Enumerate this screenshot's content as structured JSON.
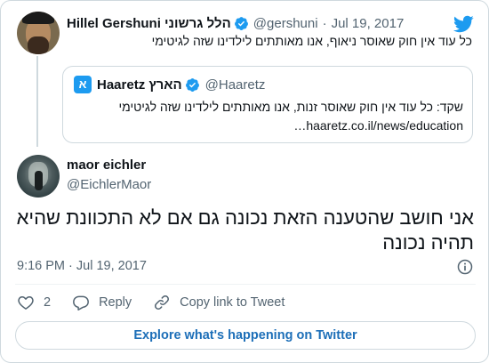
{
  "parent_tweet": {
    "name": "Hillel Gershuni הלל גרשוני",
    "handle": "@gershuni",
    "date": "Jul 19, 2017",
    "text": "כל עוד אין חוק שאוסר ניאוף, אנו מאותתים לילדינו שזה לגיטימי"
  },
  "quoted_tweet": {
    "name": "Haaretz הארץ",
    "avatar_letter": "א",
    "handle": "@Haaretz",
    "text": "שקד: כל עוד אין חוק שאוסר זנות, אנו מאותתים לילדינו שזה לגיטימי",
    "link": "haaretz.co.il/news/education…"
  },
  "main_tweet": {
    "name": "maor eichler",
    "handle": "@EichlerMaor",
    "text": "אני חושב שהטענה הזאת נכונה גם אם לא התכוונת שהיא תהיה נכונה",
    "time": "9:16 PM",
    "date": "Jul 19, 2017"
  },
  "actions": {
    "like_count": "2",
    "reply_label": "Reply",
    "copy_link_label": "Copy link to Tweet"
  },
  "explore_label": "Explore what's happening on Twitter",
  "separator": "·",
  "colors": {
    "twitter_blue": "#1d9bf0",
    "secondary_text": "#536471",
    "border": "#cfd9de"
  },
  "icons": [
    "verified-badge-icon",
    "twitter-bird-icon",
    "info-icon",
    "heart-icon",
    "reply-icon",
    "link-icon"
  ]
}
